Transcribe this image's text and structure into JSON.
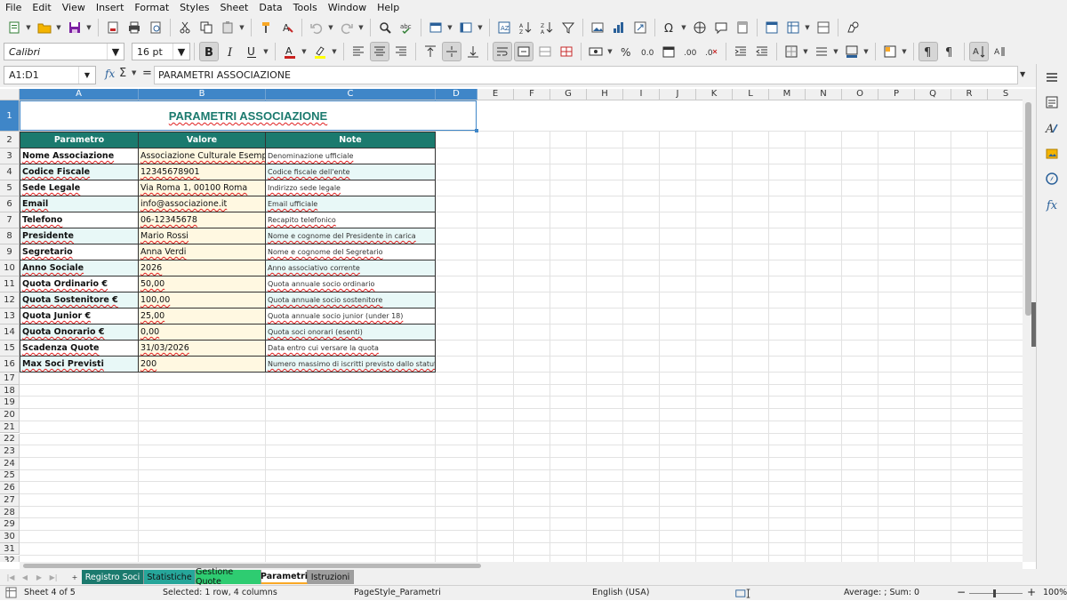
{
  "menu": [
    "File",
    "Edit",
    "View",
    "Insert",
    "Format",
    "Styles",
    "Sheet",
    "Data",
    "Tools",
    "Window",
    "Help"
  ],
  "format_toolbar": {
    "font_name": "Calibri",
    "font_size": "16 pt",
    "font_color": "#c9211e",
    "highlight_color": "#ffff00"
  },
  "formula_bar": {
    "name_box": "A1:D1",
    "content": "PARAMETRI ASSOCIAZIONE"
  },
  "columns": [
    "A",
    "B",
    "C",
    "D",
    "E",
    "F",
    "G",
    "H",
    "I",
    "J",
    "K",
    "L",
    "M",
    "N",
    "O",
    "P",
    "Q",
    "R",
    "S"
  ],
  "rows": [
    "1",
    "2",
    "3",
    "4",
    "5",
    "6",
    "7",
    "8",
    "9",
    "10",
    "11",
    "12",
    "13",
    "14",
    "15",
    "16",
    "17",
    "18",
    "19",
    "20",
    "21",
    "22",
    "23",
    "24",
    "25",
    "26",
    "27",
    "28",
    "29",
    "30",
    "31",
    "32"
  ],
  "sheet": {
    "title": "PARAMETRI ASSOCIAZIONE",
    "headers": [
      "Parametro",
      "Valore",
      "Note"
    ],
    "rows": [
      {
        "param": "Nome Associazione",
        "value": "Associazione Culturale Esempio APS",
        "note": "Denominazione ufficiale"
      },
      {
        "param": "Codice Fiscale",
        "value": "12345678901",
        "note": "Codice fiscale dell'ente"
      },
      {
        "param": "Sede Legale",
        "value": "Via Roma 1, 00100 Roma",
        "note": "Indirizzo sede legale"
      },
      {
        "param": "Email",
        "value": "info@associazione.it",
        "note": "Email ufficiale"
      },
      {
        "param": "Telefono",
        "value": "06-12345678",
        "note": "Recapito telefonico"
      },
      {
        "param": "Presidente",
        "value": "Mario Rossi",
        "note": "Nome e cognome del Presidente in carica"
      },
      {
        "param": "Segretario",
        "value": "Anna Verdi",
        "note": "Nome e cognome del Segretario"
      },
      {
        "param": "Anno Sociale",
        "value": "2026",
        "note": "Anno associativo corrente"
      },
      {
        "param": "Quota Ordinario €",
        "value": "50,00",
        "note": "Quota annuale socio ordinario"
      },
      {
        "param": "Quota Sostenitore €",
        "value": "100,00",
        "note": "Quota annuale socio sostenitore"
      },
      {
        "param": "Quota Junior €",
        "value": "25,00",
        "note": "Quota annuale socio junior (under 18)"
      },
      {
        "param": "Quota Onorario €",
        "value": "0,00",
        "note": "Quota soci onorari (esenti)"
      },
      {
        "param": "Scadenza Quote",
        "value": "31/03/2026",
        "note": "Data entro cui versare la quota"
      },
      {
        "param": "Max Soci Previsti",
        "value": "200",
        "note": "Numero massimo di iscritti previsto dallo statuto"
      }
    ]
  },
  "tabs": [
    {
      "label": "Registro Soci",
      "color": "#1b7a6e",
      "text": "#ffffff"
    },
    {
      "label": "Statistiche",
      "color": "#26a69a",
      "text": "#111111"
    },
    {
      "label": "Gestione Quote",
      "color": "#2ecc71",
      "text": "#111111"
    },
    {
      "label": "Parametri",
      "color": "#ffffff",
      "text": "#111111"
    },
    {
      "label": "Istruzioni",
      "color": "#9e9e9e",
      "text": "#111111"
    }
  ],
  "status": {
    "sheet": "Sheet 4 of 5",
    "selection": "Selected: 1 row, 4 columns",
    "page_style": "PageStyle_Parametri",
    "language": "English (USA)",
    "summary": "Average: ; Sum: 0",
    "zoom": "100%"
  },
  "colors": {
    "header_bg": "#1b7a6e",
    "title": "#1b7a6e",
    "selection": "#3f86c8",
    "band_a": "#e8f8f7",
    "band_b": "#ffffff",
    "value_bg": "#fff8e1"
  }
}
